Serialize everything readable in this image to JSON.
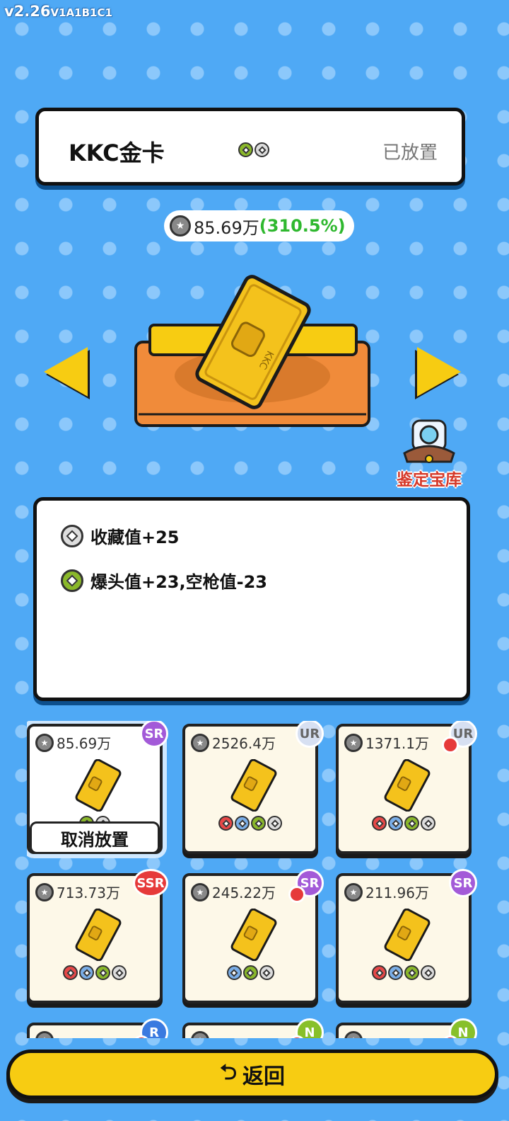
{
  "version": {
    "main": "v2.26",
    "build": "V1A1B1C1"
  },
  "item": {
    "name": "KKC金卡",
    "status": "已放置",
    "value": "85.69万",
    "percent": "(310.5%)"
  },
  "vault": {
    "label": "鉴定宝库"
  },
  "attributes": [
    {
      "text": "收藏值+25",
      "color": "grey"
    },
    {
      "text": "爆头值+23,空枪值-23",
      "color": "green"
    }
  ],
  "cards": [
    {
      "value": "85.69万",
      "rarity": "SR",
      "dots": [
        "green",
        "grey"
      ],
      "selected": true,
      "notif": false
    },
    {
      "value": "2526.4万",
      "rarity": "UR",
      "dots": [
        "red",
        "blue",
        "green",
        "grey"
      ],
      "selected": false,
      "notif": false
    },
    {
      "value": "1371.1万",
      "rarity": "UR",
      "dots": [
        "red",
        "blue",
        "green",
        "grey"
      ],
      "selected": false,
      "notif": true
    },
    {
      "value": "713.73万",
      "rarity": "SSR",
      "dots": [
        "red",
        "blue",
        "green",
        "grey"
      ],
      "selected": false,
      "notif": false
    },
    {
      "value": "245.22万",
      "rarity": "SR",
      "dots": [
        "blue",
        "green",
        "grey"
      ],
      "selected": false,
      "notif": true
    },
    {
      "value": "211.96万",
      "rarity": "SR",
      "dots": [
        "red",
        "blue",
        "green",
        "grey"
      ],
      "selected": false,
      "notif": false
    },
    {
      "value": "",
      "rarity": "R",
      "dots": [],
      "selected": false,
      "notif": true
    },
    {
      "value": "",
      "rarity": "N",
      "dots": [],
      "selected": false,
      "notif": true
    },
    {
      "value": "",
      "rarity": "N",
      "dots": [],
      "selected": false,
      "notif": true
    }
  ],
  "cancel_label": "取消放置",
  "return_label": "返回",
  "icons": {
    "return": "return-arrow-icon",
    "coin": "coin-icon"
  }
}
